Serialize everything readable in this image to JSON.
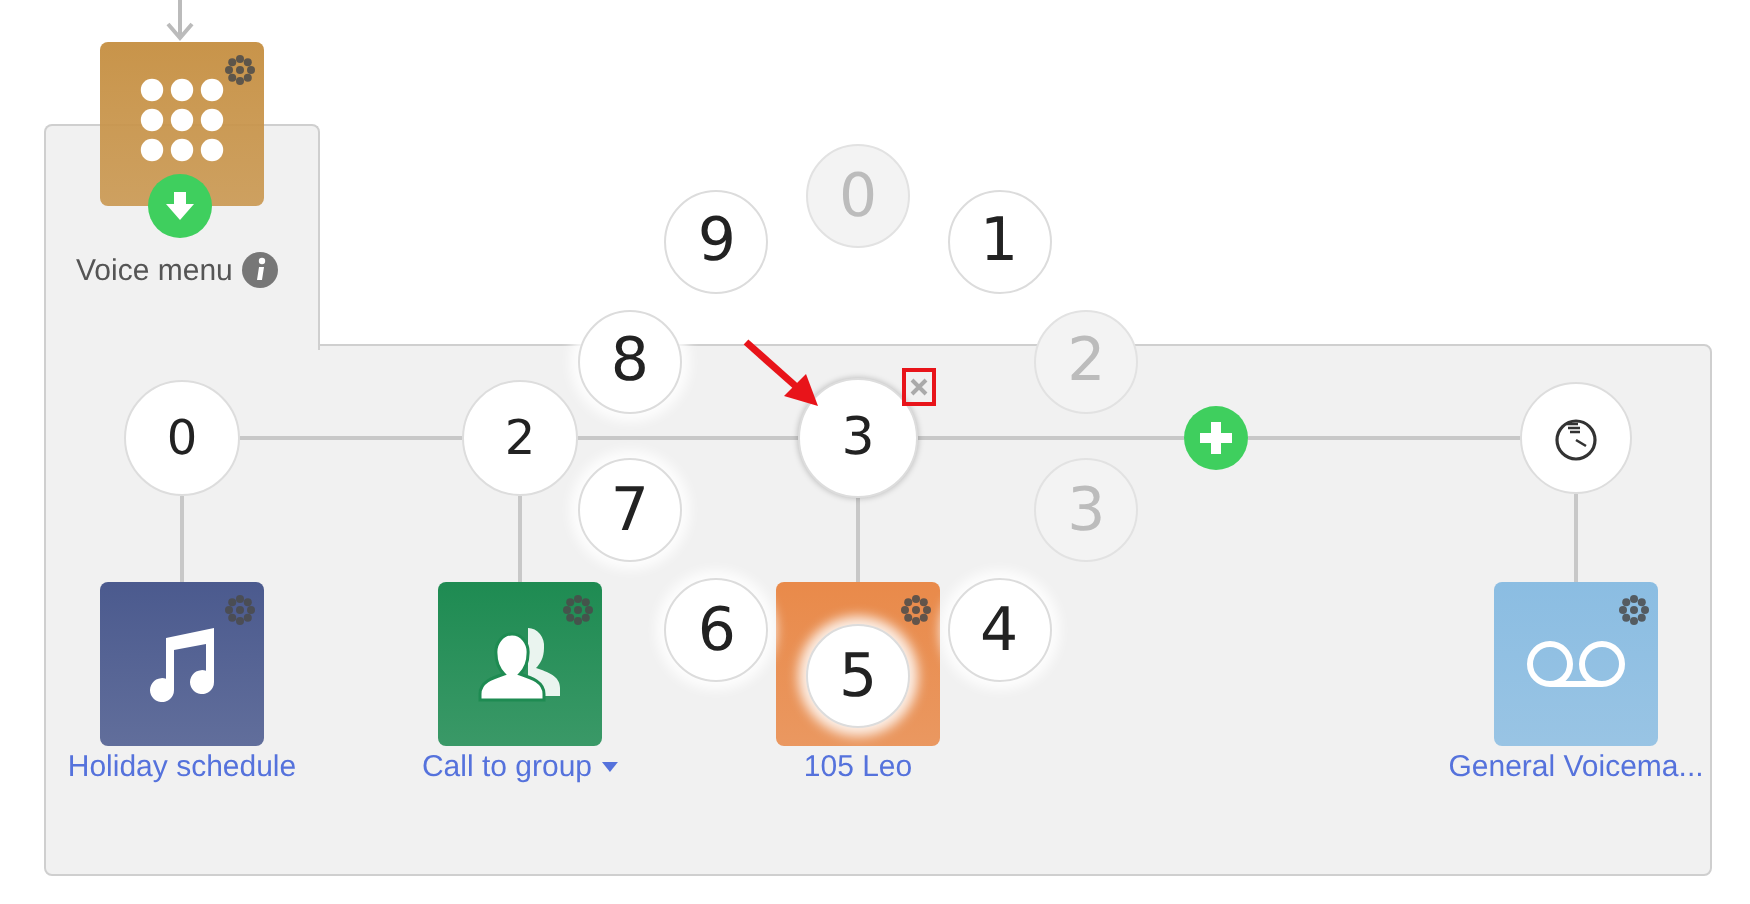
{
  "voice_menu": {
    "label": "Voice menu",
    "color": "#c8944a"
  },
  "branches": [
    {
      "kind": "key",
      "key": "0",
      "selected": false,
      "target": {
        "label": "Holiday schedule",
        "kind": "schedule",
        "color": "#4b5a8e",
        "dropdown": false
      }
    },
    {
      "kind": "key",
      "key": "2",
      "selected": false,
      "target": {
        "label": "Call to group",
        "kind": "group",
        "color": "#1e8b52",
        "dropdown": true
      }
    },
    {
      "kind": "key",
      "key": "3",
      "selected": true,
      "target": {
        "label": "105 Leo",
        "kind": "extension",
        "color": "#e98a4a",
        "dropdown": false
      }
    },
    {
      "kind": "timeout",
      "selected": false,
      "target": {
        "label": "General Voicema...",
        "kind": "voicemail",
        "color": "#8bbde2",
        "dropdown": false
      }
    }
  ],
  "key_picker": {
    "digits": [
      {
        "label": "0",
        "disabled": true
      },
      {
        "label": "1",
        "disabled": false
      },
      {
        "label": "2",
        "disabled": true
      },
      {
        "label": "3",
        "disabled": true
      },
      {
        "label": "4",
        "disabled": false
      },
      {
        "label": "5",
        "disabled": false
      },
      {
        "label": "6",
        "disabled": false
      },
      {
        "label": "7",
        "disabled": false
      },
      {
        "label": "8",
        "disabled": false
      },
      {
        "label": "9",
        "disabled": false
      }
    ]
  }
}
